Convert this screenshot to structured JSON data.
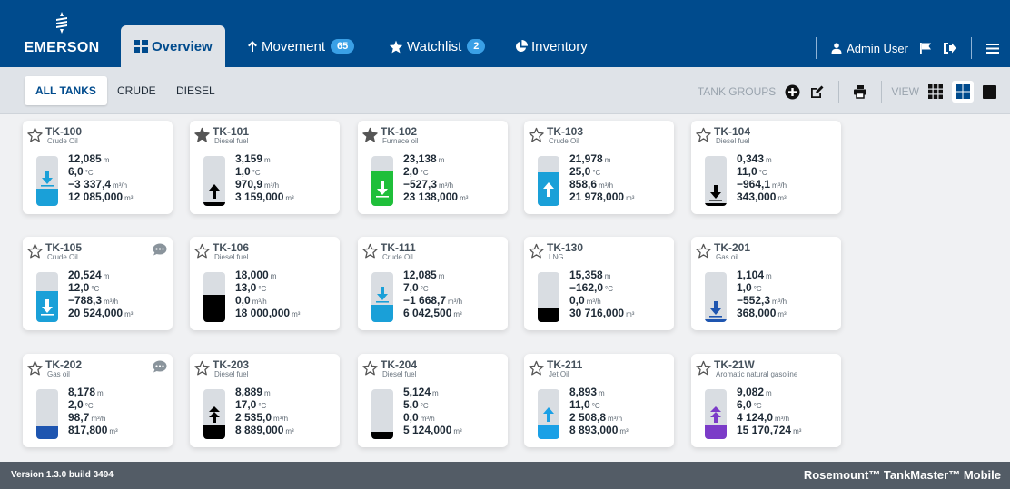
{
  "header": {
    "logo_text": "EMERSON",
    "tabs": [
      {
        "label": "Overview",
        "icon": "grid-icon",
        "active": true
      },
      {
        "label": "Movement",
        "icon": "arrow-up-icon",
        "badge": "65"
      },
      {
        "label": "Watchlist",
        "icon": "star-icon",
        "badge": "2"
      },
      {
        "label": "Inventory",
        "icon": "pie-chart-icon"
      }
    ],
    "user": "Admin User",
    "icons": [
      "user-icon",
      "flag-icon",
      "logout-icon",
      "menu-icon"
    ]
  },
  "subbar": {
    "tabs": [
      "ALL TANKS",
      "CRUDE",
      "DIESEL"
    ],
    "tank_groups_label": "TANK GROUPS",
    "view_label": "VIEW"
  },
  "tanks": [
    {
      "name": "TK-100",
      "product": "Crude Oil",
      "level": "12,085",
      "level_u": "m",
      "temp": "6,0",
      "temp_u": "°C",
      "flow": "−3 337,4",
      "flow_u": "m³/h",
      "volume": "12 085,000",
      "vol_u": "m³",
      "fill_fraction": 0.35,
      "color": "#1aa0d8",
      "arrow": "down",
      "arrow_color": "#1aa0d8",
      "starred": false,
      "chat": false
    },
    {
      "name": "TK-101",
      "product": "Diesel fuel",
      "level": "3,159",
      "level_u": "m",
      "temp": "1,0",
      "temp_u": "°C",
      "flow": "970,9",
      "flow_u": "m³/h",
      "volume": "3 159,000",
      "vol_u": "m³",
      "fill_fraction": 0.08,
      "color": "#000000",
      "arrow": "up",
      "arrow_color": "#000000",
      "starred": true,
      "chat": false
    },
    {
      "name": "TK-102",
      "product": "Furnace oil",
      "level": "23,138",
      "level_u": "m",
      "temp": "2,0",
      "temp_u": "°C",
      "flow": "−527,3",
      "flow_u": "m³/h",
      "volume": "23 138,000",
      "vol_u": "m³",
      "fill_fraction": 0.7,
      "color": "#1fbf3a",
      "arrow": "down",
      "arrow_color": "#ffffff",
      "starred": true,
      "chat": false
    },
    {
      "name": "TK-103",
      "product": "Crude Oil",
      "level": "21,978",
      "level_u": "m",
      "temp": "25,0",
      "temp_u": "°C",
      "flow": "858,6",
      "flow_u": "m³/h",
      "volume": "21 978,000",
      "vol_u": "m³",
      "fill_fraction": 0.68,
      "color": "#1aa0d8",
      "arrow": "up",
      "arrow_color": "#ffffff",
      "starred": false,
      "chat": false
    },
    {
      "name": "TK-104",
      "product": "Diesel fuel",
      "level": "0,343",
      "level_u": "m",
      "temp": "11,0",
      "temp_u": "°C",
      "flow": "−964,1",
      "flow_u": "m³/h",
      "volume": "343,000",
      "vol_u": "m³",
      "fill_fraction": 0.02,
      "color": "#000000",
      "arrow": "down",
      "arrow_color": "#000000",
      "starred": false,
      "chat": false
    },
    {
      "name": "TK-105",
      "product": "Crude Oil",
      "level": "20,524",
      "level_u": "m",
      "temp": "12,0",
      "temp_u": "°C",
      "flow": "−788,3",
      "flow_u": "m³/h",
      "volume": "20 524,000",
      "vol_u": "m³",
      "fill_fraction": 0.62,
      "color": "#1aa0d8",
      "arrow": "down",
      "arrow_color": "#ffffff",
      "starred": false,
      "chat": true
    },
    {
      "name": "TK-106",
      "product": "Diesel fuel",
      "level": "18,000",
      "level_u": "m",
      "temp": "13,0",
      "temp_u": "°C",
      "flow": "0,0",
      "flow_u": "m³/h",
      "volume": "18 000,000",
      "vol_u": "m³",
      "fill_fraction": 0.55,
      "color": "#000000",
      "arrow": "none",
      "arrow_color": "#000000",
      "starred": false,
      "chat": false
    },
    {
      "name": "TK-111",
      "product": "Crude Oil",
      "level": "12,085",
      "level_u": "m",
      "temp": "7,0",
      "temp_u": "°C",
      "flow": "−1 668,7",
      "flow_u": "m³/h",
      "volume": "6 042,500",
      "vol_u": "m³",
      "fill_fraction": 0.35,
      "color": "#1aa0d8",
      "arrow": "down",
      "arrow_color": "#1aa0d8",
      "starred": false,
      "chat": false
    },
    {
      "name": "TK-130",
      "product": "LNG",
      "level": "15,358",
      "level_u": "m",
      "temp": "−162,0",
      "temp_u": "°C",
      "flow": "0,0",
      "flow_u": "m³/h",
      "volume": "30 716,000",
      "vol_u": "m³",
      "fill_fraction": 0.28,
      "color": "#000000",
      "arrow": "none",
      "arrow_color": "#000000",
      "starred": false,
      "chat": false
    },
    {
      "name": "TK-201",
      "product": "Gas oil",
      "level": "1,104",
      "level_u": "m",
      "temp": "1,0",
      "temp_u": "°C",
      "flow": "−552,3",
      "flow_u": "m³/h",
      "volume": "368,000",
      "vol_u": "m³",
      "fill_fraction": 0.04,
      "color": "#1e55b0",
      "arrow": "down",
      "arrow_color": "#1e55b0",
      "starred": false,
      "chat": false
    },
    {
      "name": "TK-202",
      "product": "Gas oil",
      "level": "8,178",
      "level_u": "m",
      "temp": "2,0",
      "temp_u": "°C",
      "flow": "98,7",
      "flow_u": "m³/h",
      "volume": "817,800",
      "vol_u": "m³",
      "fill_fraction": 0.25,
      "color": "#1e55b0",
      "arrow": "none",
      "arrow_color": "#1e55b0",
      "starred": false,
      "chat": true
    },
    {
      "name": "TK-203",
      "product": "Diesel fuel",
      "level": "8,889",
      "level_u": "m",
      "temp": "17,0",
      "temp_u": "°C",
      "flow": "2 535,0",
      "flow_u": "m³/h",
      "volume": "8 889,000",
      "vol_u": "m³",
      "fill_fraction": 0.27,
      "color": "#000000",
      "arrow": "upup",
      "arrow_color": "#000000",
      "starred": false,
      "chat": false
    },
    {
      "name": "TK-204",
      "product": "Diesel fuel",
      "level": "5,124",
      "level_u": "m",
      "temp": "5,0",
      "temp_u": "°C",
      "flow": "0,0",
      "flow_u": "m³/h",
      "volume": "5 124,000",
      "vol_u": "m³",
      "fill_fraction": 0.15,
      "color": "#000000",
      "arrow": "none",
      "arrow_color": "#000000",
      "starred": false,
      "chat": false
    },
    {
      "name": "TK-211",
      "product": "Jet Oil",
      "level": "8,893",
      "level_u": "m",
      "temp": "11,0",
      "temp_u": "°C",
      "flow": "2 508,8",
      "flow_u": "m³/h",
      "volume": "8 893,000",
      "vol_u": "m³",
      "fill_fraction": 0.28,
      "color": "#1aa0e6",
      "arrow": "up",
      "arrow_color": "#1aa0e6",
      "starred": false,
      "chat": false
    },
    {
      "name": "TK-21W",
      "product": "Aromatic natural gasoline",
      "level": "9,082",
      "level_u": "m",
      "temp": "6,0",
      "temp_u": "°C",
      "flow": "4 124,0",
      "flow_u": "m³/h",
      "volume": "15 170,724",
      "vol_u": "m³",
      "fill_fraction": 0.28,
      "color": "#7b3bc8",
      "arrow": "upup",
      "arrow_color": "#7b3bc8",
      "starred": false,
      "chat": false
    }
  ],
  "footer": {
    "version": "Version 1.3.0 build 3494",
    "brand": "Rosemount™ TankMaster™ Mobile"
  }
}
